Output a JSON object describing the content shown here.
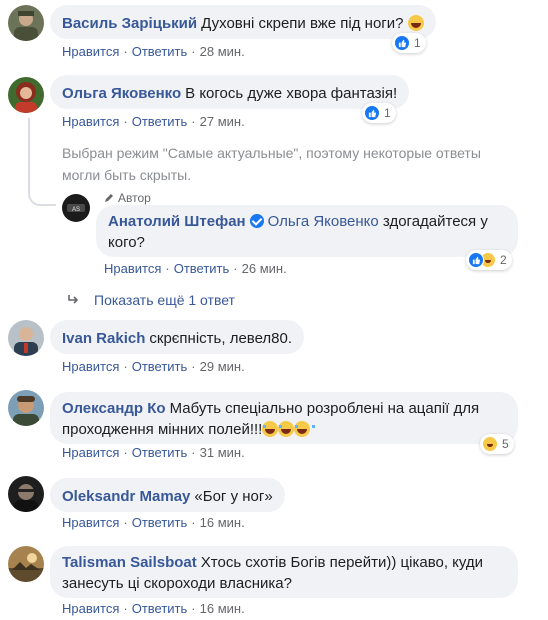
{
  "comments": [
    {
      "author": "Василь Заріцький",
      "text": "Духовні скрепи вже під ноги?",
      "like_label": "Нравится",
      "reply_label": "Ответить",
      "time": "28 мин.",
      "reactions": "1"
    },
    {
      "author": "Ольга Яковенко",
      "text": "В когось дуже хвора фантазія!",
      "like_label": "Нравится",
      "reply_label": "Ответить",
      "time": "27 мин.",
      "reactions": "1"
    },
    {
      "author": "Ivan Rakich",
      "text": "скрєпність, левел80.",
      "like_label": "Нравится",
      "reply_label": "Ответить",
      "time": "29 мин."
    },
    {
      "author": "Олександр Ко",
      "text_line1": "Мабуть спеціально розроблені на ацапії для",
      "text_line2": "проходження мінних полей!!!",
      "like_label": "Нравится",
      "reply_label": "Ответить",
      "time": "31 мин.",
      "reactions": "5"
    },
    {
      "author": "Oleksandr Mamay",
      "text": "«Бог у ног»",
      "like_label": "Нравится",
      "reply_label": "Ответить",
      "time": "16 мин."
    },
    {
      "author": "Talisman Sailsboat",
      "text_line1": "Хтось схотів Богів перейти)) цікаво, куди",
      "text_line2": "занесуть ці скороходи власника?",
      "like_label": "Нравится",
      "reply_label": "Ответить",
      "time": "16 мин."
    }
  ],
  "notice": {
    "line1": "Выбран режим \"Самые актуальные\", поэтому некоторые ответы",
    "line2": "могли быть скрыты."
  },
  "reply": {
    "badge": "Автор",
    "author": "Анатолий Штефан",
    "mention": "Ольга Яковенко",
    "text_line1": "здогадайтеся у",
    "text_line2": "кого?",
    "like_label": "Нравится",
    "reply_label": "Ответить",
    "time": "26 мин.",
    "reactions": "2"
  },
  "show_more": "Показать ещё 1 ответ",
  "colors": {
    "link": "#385898",
    "bubble": "#f0f2f5",
    "meta": "#65676b",
    "like": "#1877f2",
    "haha": "#f7c948"
  }
}
